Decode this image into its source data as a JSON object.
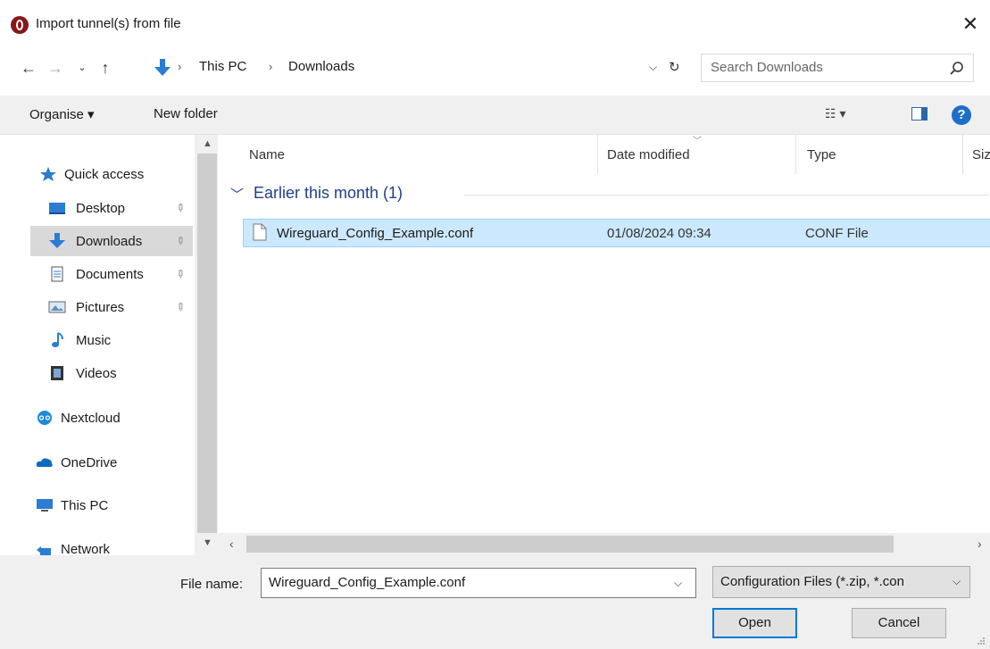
{
  "window": {
    "title": "Import tunnel(s) from file",
    "close_glyph": "✕"
  },
  "address_bar": {
    "crumbs": [
      "This PC",
      "Downloads"
    ],
    "search_placeholder": "Search Downloads"
  },
  "toolbar": {
    "organise_label": "Organise ▾",
    "new_folder_label": "New folder",
    "help_glyph": "?"
  },
  "navigation": {
    "items": [
      {
        "label": "Quick access",
        "icon": "star-icon"
      },
      {
        "label": "Desktop",
        "icon": "desktop-icon",
        "pinned": true
      },
      {
        "label": "Downloads",
        "icon": "downloads-icon",
        "pinned": true,
        "selected": true
      },
      {
        "label": "Documents",
        "icon": "documents-icon",
        "pinned": true
      },
      {
        "label": "Pictures",
        "icon": "pictures-icon",
        "pinned": true
      },
      {
        "label": "Music",
        "icon": "music-icon"
      },
      {
        "label": "Videos",
        "icon": "videos-icon"
      },
      {
        "label": "Nextcloud",
        "icon": "nextcloud-icon"
      },
      {
        "label": "OneDrive",
        "icon": "onedrive-icon"
      },
      {
        "label": "This PC",
        "icon": "this-pc-icon"
      },
      {
        "label": "Network",
        "icon": "network-icon"
      }
    ]
  },
  "file_list": {
    "columns": [
      "Name",
      "Date modified",
      "Type",
      "Size"
    ],
    "group_label": "Earlier this month (1)",
    "rows": [
      {
        "name": "Wireguard_Config_Example.conf",
        "date": "01/08/2024 09:34",
        "type": "CONF File"
      }
    ]
  },
  "footer": {
    "file_name_label": "File name:",
    "file_name_value": "Wireguard_Config_Example.conf",
    "file_type_value": "Configuration Files (*.zip, *.con",
    "open_label": "Open",
    "cancel_label": "Cancel"
  },
  "colors": {
    "accent": "#0078d7",
    "selection": "#cce8ff",
    "group_header": "#1e3f8b"
  }
}
